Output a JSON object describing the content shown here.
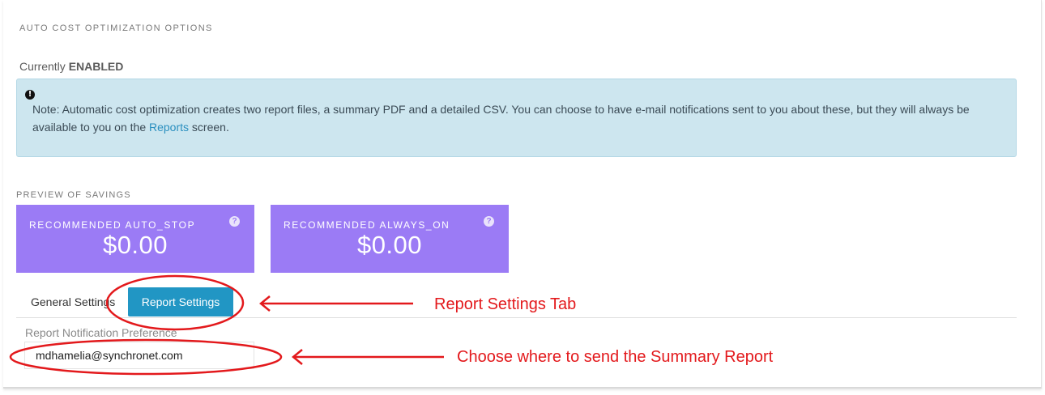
{
  "section": {
    "title": "AUTO COST OPTIMIZATION OPTIONS",
    "status_prefix": "Currently",
    "status_value": "ENABLED"
  },
  "note": {
    "icon": "exclamation-circle-icon",
    "text_before_link": "Note: Automatic cost optimization creates two report files, a summary PDF and a detailed CSV. You can choose to have e-mail notifications sent to you about these, but they will always be available to you on the ",
    "link_text": "Reports",
    "text_after_link": " screen."
  },
  "preview": {
    "title": "PREVIEW OF SAVINGS",
    "tiles": [
      {
        "label": "RECOMMENDED AUTO_STOP",
        "value": "$0.00",
        "icon": "question-circle-icon"
      },
      {
        "label": "RECOMMENDED ALWAYS_ON",
        "value": "$0.00",
        "icon": "question-circle-icon"
      }
    ]
  },
  "tabs": {
    "general_label": "General Settings",
    "report_label": "Report Settings",
    "active": "Report Settings"
  },
  "report_settings": {
    "field_label": "Report Notification Preference",
    "email_value": "mdhamelia@synchronet.com"
  },
  "annotations": {
    "tab_callout": "Report Settings Tab",
    "email_callout": "Choose where to send the Summary Report",
    "color": "#e3191c"
  },
  "colors": {
    "tile_bg": "#9b7bf5",
    "note_bg": "#cde6ef",
    "active_tab_bg": "#2196c4",
    "link": "#2a8fbf"
  }
}
